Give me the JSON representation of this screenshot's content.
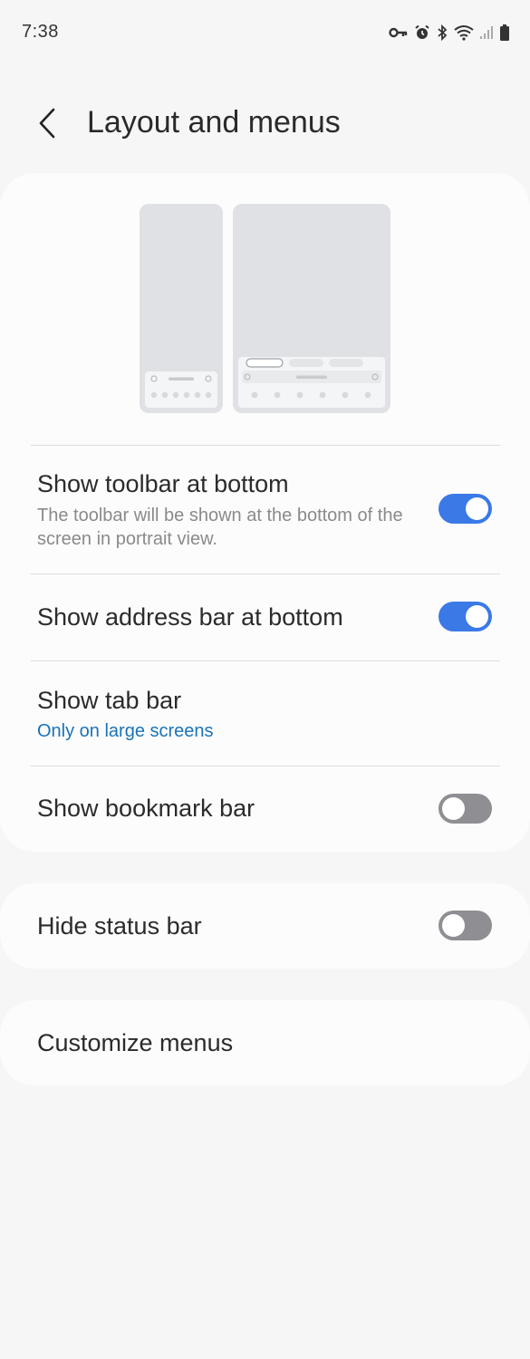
{
  "status_bar": {
    "time": "7:38",
    "icons": [
      "vpn-key-icon",
      "alarm-icon",
      "bluetooth-icon",
      "wifi-icon",
      "signal-icon",
      "battery-icon"
    ]
  },
  "header": {
    "back_icon": "chevron-left-icon",
    "title": "Layout and menus"
  },
  "settings": {
    "toolbar_bottom": {
      "title": "Show toolbar at bottom",
      "description": "The toolbar will be shown at the bottom of the screen in portrait view.",
      "enabled": true
    },
    "address_bar_bottom": {
      "title": "Show address bar at bottom",
      "enabled": true
    },
    "tab_bar": {
      "title": "Show tab bar",
      "value": "Only on large screens"
    },
    "bookmark_bar": {
      "title": "Show bookmark bar",
      "enabled": false
    },
    "hide_status_bar": {
      "title": "Hide status bar",
      "enabled": false
    },
    "customize_menus": {
      "title": "Customize menus"
    }
  },
  "colors": {
    "accent": "#3b79e7",
    "link": "#1a73b8",
    "switch_off": "#8e8e93",
    "background": "#f6f6f6",
    "card": "#fcfcfc"
  }
}
